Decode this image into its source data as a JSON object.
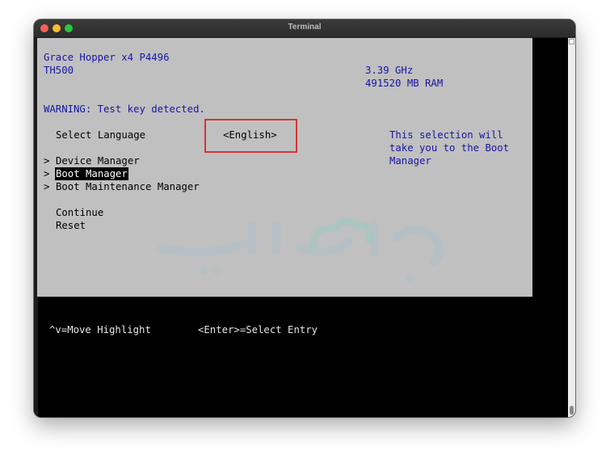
{
  "window": {
    "title": "Terminal"
  },
  "bios": {
    "model": "Grace Hopper x4 P4496",
    "platform": "TH500",
    "cpu_speed": "3.39 GHz",
    "ram": "491520 MB RAM",
    "warning": "WARNING: Test key detected.",
    "select_language_label": "Select Language",
    "language_value": "<English>",
    "help_text": [
      "This selection will",
      "take you to the Boot",
      "Manager"
    ],
    "menu": [
      {
        "arrow": ">",
        "label": "Device Manager"
      },
      {
        "arrow": ">",
        "label": "Boot Manager"
      },
      {
        "arrow": ">",
        "label": "Boot Maintenance Manager"
      }
    ],
    "continue_label": "Continue",
    "reset_label": "Reset"
  },
  "footer": {
    "move_hint": "^v=Move Highlight",
    "enter_hint": "<Enter>=Select Entry"
  },
  "colors": {
    "screen_bg": "#c0c0c0",
    "text_blue": "#1515a6",
    "highlight_bg": "#000000",
    "annotation_red": "#d63434"
  }
}
